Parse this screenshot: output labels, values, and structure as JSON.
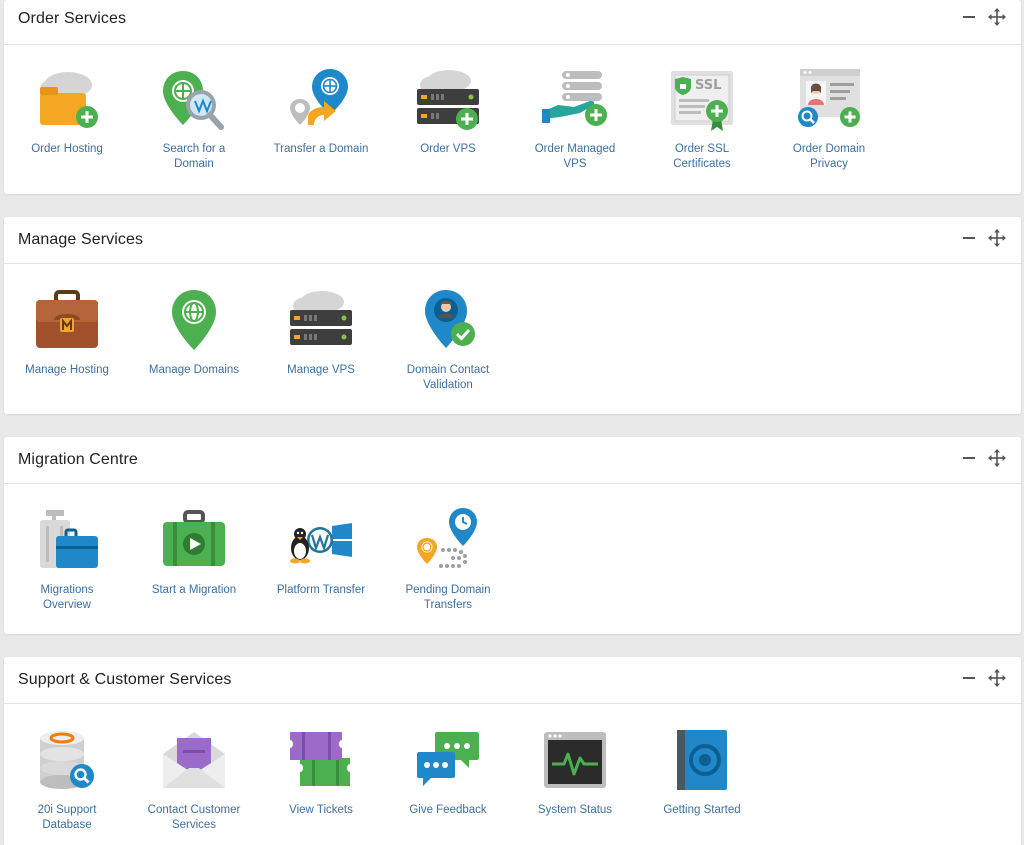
{
  "sections": [
    {
      "title": "Order Services",
      "tiles": [
        {
          "label": "Order Hosting",
          "icon": "folder-cloud-add-icon"
        },
        {
          "label": "Search for a Domain",
          "icon": "domain-search-icon"
        },
        {
          "label": "Transfer a Domain",
          "icon": "domain-transfer-icon"
        },
        {
          "label": "Order VPS",
          "icon": "server-cloud-add-icon"
        },
        {
          "label": "Order Managed VPS",
          "icon": "managed-server-hand-icon"
        },
        {
          "label": "Order SSL Certificates",
          "icon": "ssl-certificate-icon"
        },
        {
          "label": "Order Domain Privacy",
          "icon": "domain-privacy-icon"
        }
      ]
    },
    {
      "title": "Manage Services",
      "tiles": [
        {
          "label": "Manage Hosting",
          "icon": "briefcase-icon"
        },
        {
          "label": "Manage Domains",
          "icon": "globe-pin-icon"
        },
        {
          "label": "Manage VPS",
          "icon": "server-cloud-icon"
        },
        {
          "label": "Domain Contact Validation",
          "icon": "contact-check-icon"
        }
      ]
    },
    {
      "title": "Migration Centre",
      "tiles": [
        {
          "label": "Migrations Overview",
          "icon": "luggage-icon"
        },
        {
          "label": "Start a Migration",
          "icon": "suitcase-play-icon"
        },
        {
          "label": "Platform Transfer",
          "icon": "platform-logos-icon"
        },
        {
          "label": "Pending Domain Transfers",
          "icon": "pending-transfer-icon"
        }
      ]
    },
    {
      "title": "Support & Customer Services",
      "tiles": [
        {
          "label": "20i Support Database",
          "icon": "database-search-icon"
        },
        {
          "label": "Contact Customer Services",
          "icon": "envelope-icon"
        },
        {
          "label": "View Tickets",
          "icon": "tickets-icon"
        },
        {
          "label": "Give Feedback",
          "icon": "chat-bubbles-icon"
        },
        {
          "label": "System Status",
          "icon": "status-monitor-icon"
        },
        {
          "label": "Getting Started",
          "icon": "book-icon"
        }
      ]
    }
  ],
  "colors": {
    "link": "#3d6fa0",
    "green": "#4caf50",
    "blue": "#1e88c8",
    "orange": "#f5a623",
    "grey": "#8e8e8e"
  }
}
